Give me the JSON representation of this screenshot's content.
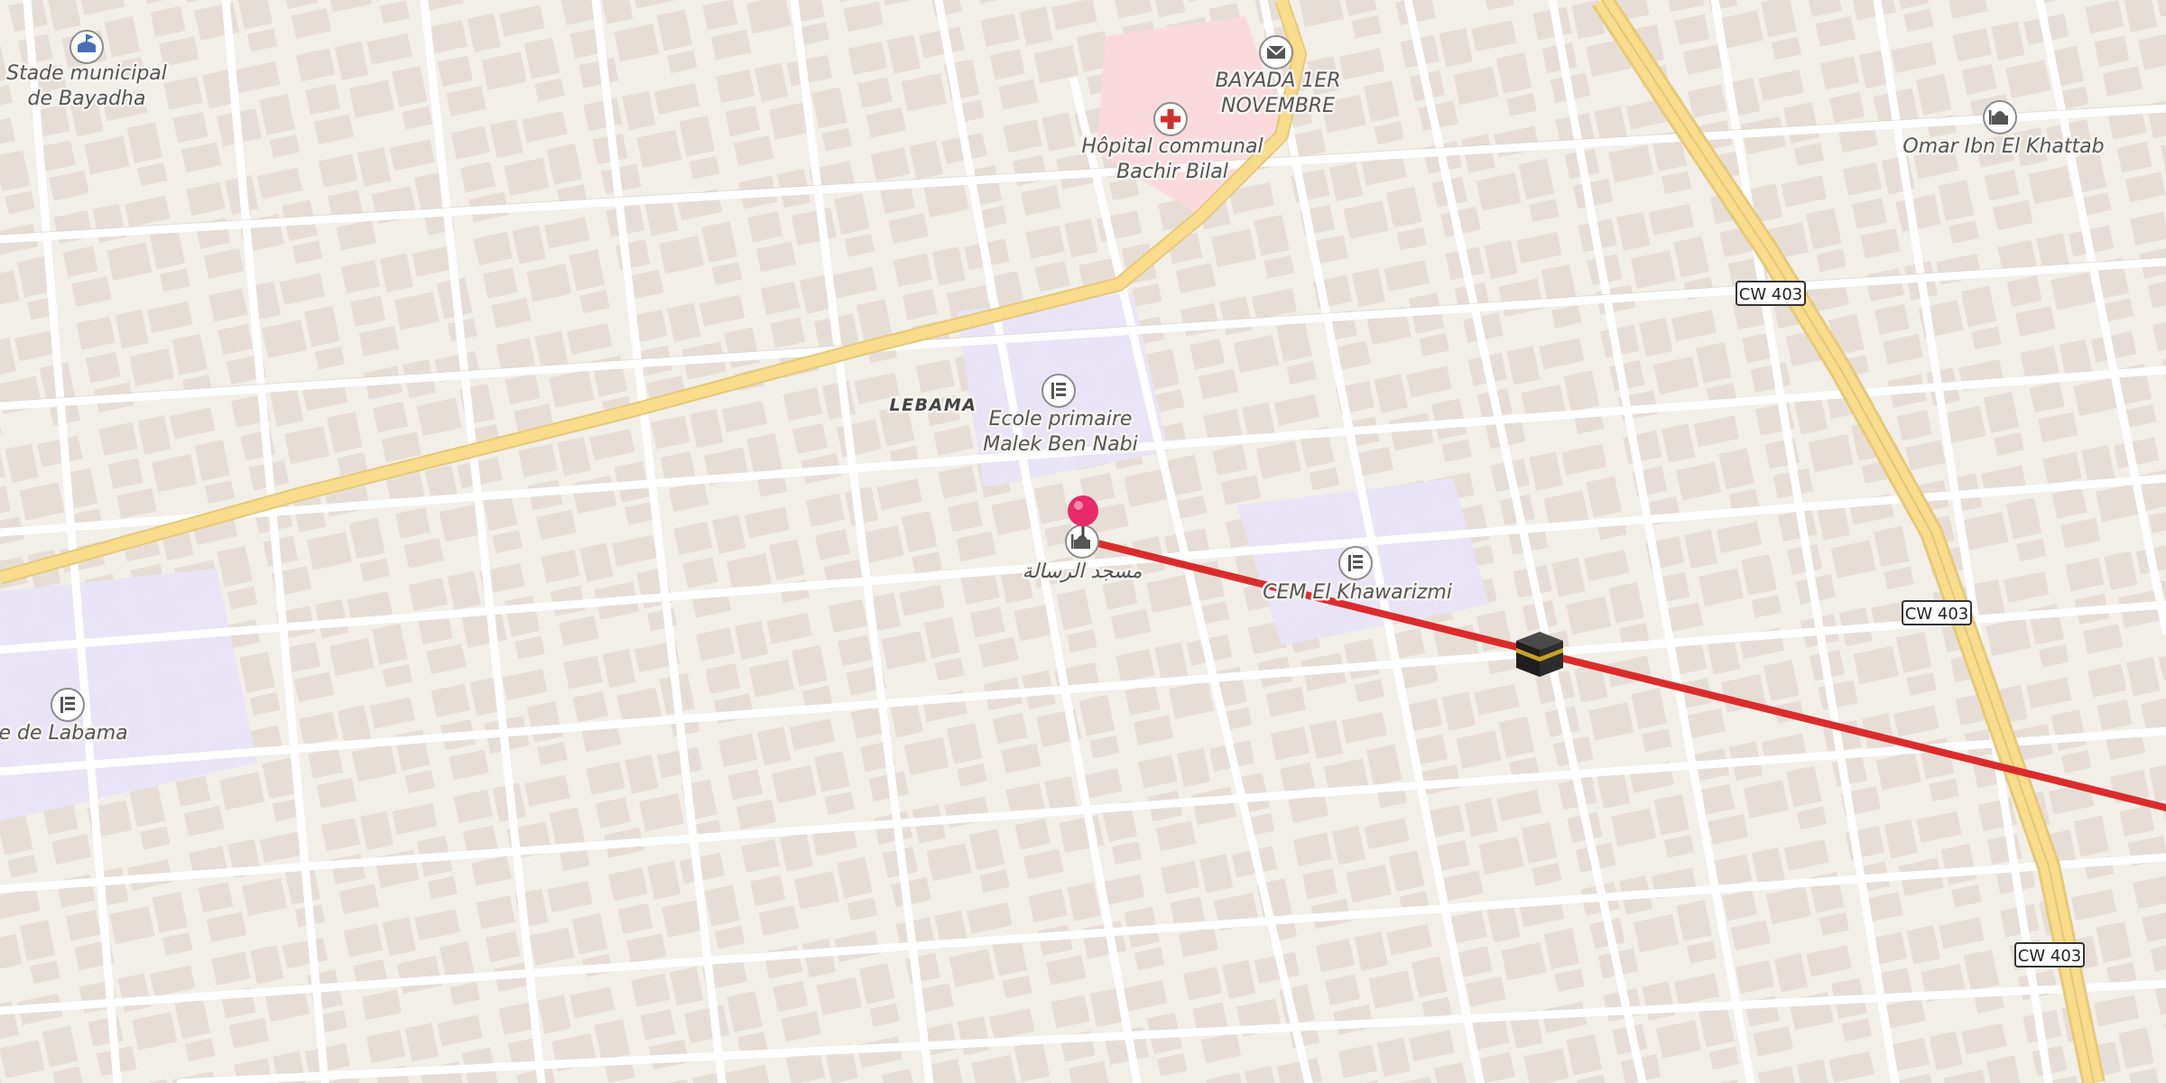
{
  "map": {
    "colors": {
      "background": "#f2efe9",
      "building": "#e2d8cf",
      "minor_road": "#ffffff",
      "major_road": "#f8dc8c",
      "hospital_area": "#fadadd",
      "school_area": "#e9e4f7",
      "route_line": "#dc2b2b",
      "pin": "#e8296a"
    },
    "labels": {
      "stadium": [
        "Stade municipal",
        "de Bayadha"
      ],
      "post_office": [
        "BAYADA 1ER",
        "NOVEMBRE"
      ],
      "hospital": [
        "Hôpital communal",
        "Bachir Bilal"
      ],
      "mosque_omar": "Omar Ibn El Khattab",
      "district": "LEBAMA",
      "school_primary": [
        "Ecole primaire",
        "Malek Ben Nabi"
      ],
      "mosque_pin": "مسجد الرسالة",
      "school_cem": "CEM El Khawarizmi",
      "lycee": "Lycée de Labama"
    },
    "road_shields": [
      "CW 403",
      "CW 403",
      "CW 403"
    ],
    "icons": {
      "stadium": "stadium-icon",
      "post_office": "post-office-icon",
      "hospital": "hospital-icon",
      "mosque": "mosque-icon",
      "school": "school-icon",
      "destination": "kaaba-icon",
      "location_pin": "location-pin-icon"
    }
  }
}
